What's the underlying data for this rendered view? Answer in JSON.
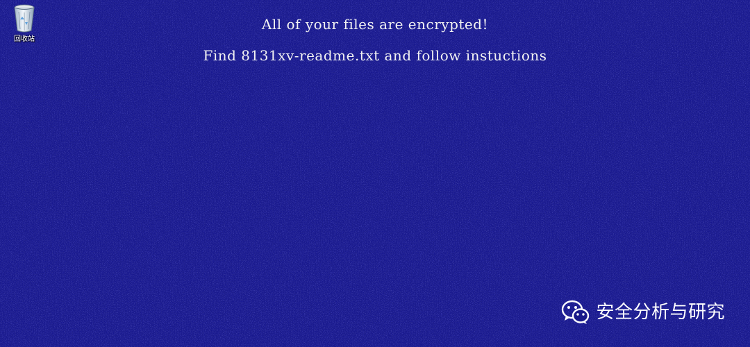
{
  "desktop": {
    "background_color": "#171790",
    "recycle_bin": {
      "label": "回收站",
      "icon": "recycle-bin-icon"
    }
  },
  "ransom_note": {
    "line1": "All of your files are encrypted!",
    "line2": "Find 8131xv-readme.txt and follow instuctions"
  },
  "watermark": {
    "text": "安全分析与研究",
    "icon": "wechat-icon"
  },
  "colors": {
    "text": "#f2f2f2",
    "accent_dark": "#06064a"
  }
}
